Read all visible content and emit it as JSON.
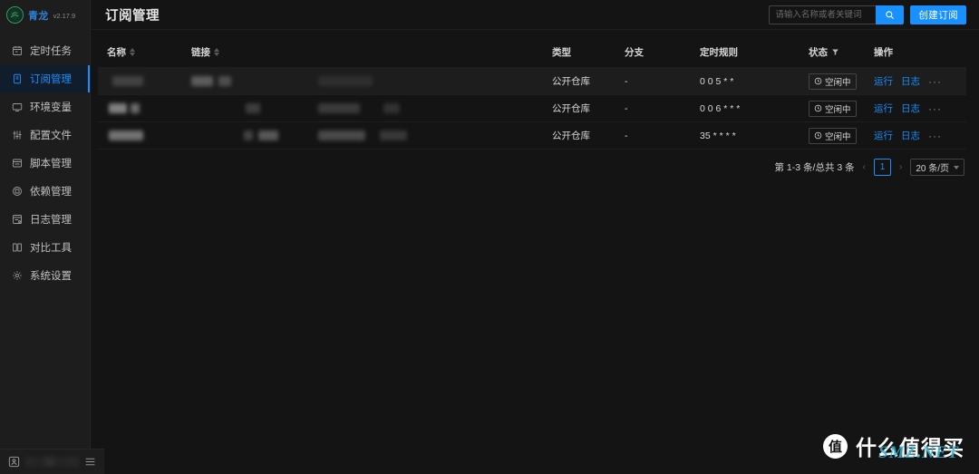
{
  "sidebar": {
    "logo": {
      "name": "青龙",
      "version": "v2.17.9",
      "icon": "dragon-logo-icon"
    },
    "items": [
      {
        "label": "定时任务",
        "icon": "schedule-icon",
        "active": false
      },
      {
        "label": "订阅管理",
        "icon": "subscription-icon",
        "active": true
      },
      {
        "label": "环境变量",
        "icon": "environment-icon",
        "active": false
      },
      {
        "label": "配置文件",
        "icon": "config-file-icon",
        "active": false
      },
      {
        "label": "脚本管理",
        "icon": "script-icon",
        "active": false
      },
      {
        "label": "依赖管理",
        "icon": "dependency-icon",
        "active": false
      },
      {
        "label": "日志管理",
        "icon": "log-icon",
        "active": false
      },
      {
        "label": "对比工具",
        "icon": "diff-tool-icon",
        "active": false
      },
      {
        "label": "系统设置",
        "icon": "settings-gear-icon",
        "active": false
      }
    ],
    "userbar": {
      "user_icon": "user-icon",
      "menu_icon": "list-menu-icon",
      "username_redacted": ""
    }
  },
  "header": {
    "title": "订阅管理",
    "search": {
      "placeholder": "请输入名称或者关键词",
      "value": "",
      "icon": "search-icon"
    },
    "create_button": {
      "label": "创建订阅"
    },
    "accent_color": "#1890ff"
  },
  "table": {
    "columns": [
      {
        "label": "名称",
        "sortable": true
      },
      {
        "label": "链接",
        "sortable": true
      },
      {
        "label": "类型",
        "sortable": false
      },
      {
        "label": "分支",
        "sortable": false
      },
      {
        "label": "定时规则",
        "sortable": false
      },
      {
        "label": "状态",
        "filterable": true,
        "filter_icon": "filter-icon"
      },
      {
        "label": "操作",
        "sortable": false
      }
    ],
    "rows": [
      {
        "name": "",
        "link": "",
        "type": "公开仓库",
        "branch": "-",
        "cron": "0 0 5 * *",
        "status": {
          "label": "空闲中",
          "icon": "clock-icon"
        },
        "ops": {
          "run": "运行",
          "log": "日志",
          "more": "···"
        },
        "hovered": true
      },
      {
        "name": "",
        "link": "",
        "type": "公开仓库",
        "branch": "-",
        "cron": "0 0 6 * * *",
        "status": {
          "label": "空闲中",
          "icon": "clock-icon"
        },
        "ops": {
          "run": "运行",
          "log": "日志",
          "more": "···"
        },
        "hovered": false
      },
      {
        "name": "",
        "link": "",
        "type": "公开仓库",
        "branch": "-",
        "cron": "35 * * * *",
        "status": {
          "label": "空闲中",
          "icon": "clock-icon"
        },
        "ops": {
          "run": "运行",
          "log": "日志",
          "more": "···"
        },
        "hovered": false
      }
    ]
  },
  "pagination": {
    "summary": "第 1-3 条/总共 3 条",
    "prev_icon": "chevron-left-icon",
    "next_icon": "chevron-right-icon",
    "current_page": "1",
    "page_size": "20 条/页"
  },
  "watermark": {
    "badge": "值",
    "text": "什么值得买",
    "overlay": "SMZ.NET"
  }
}
